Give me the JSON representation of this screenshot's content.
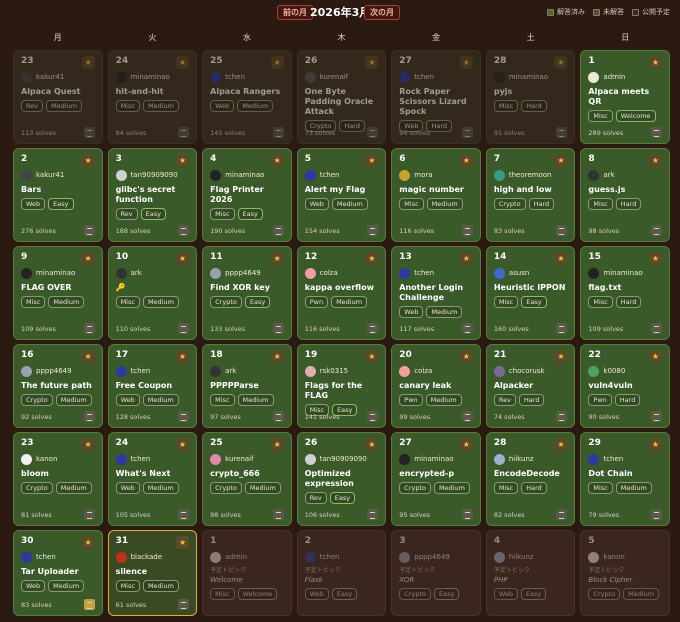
{
  "header": {
    "prev_label": "前の月",
    "title": "2026年3月",
    "next_label": "次の月"
  },
  "legend": [
    {
      "label": "解答済み",
      "color": "#4a6a2a"
    },
    {
      "label": "未解答",
      "color": "#5a4a3a"
    },
    {
      "label": "公開予定",
      "color": "#3a2a22"
    }
  ],
  "weekdays": [
    "月",
    "火",
    "水",
    "木",
    "金",
    "土",
    "日"
  ],
  "days": [
    {
      "day": "23",
      "state": "past",
      "author": "kakur41",
      "avatar_color": "#444444",
      "title": "Alpaca Quest",
      "tags": [
        "Rev",
        "Medium"
      ],
      "solves": "113 solves"
    },
    {
      "day": "24",
      "state": "past",
      "author": "minaminao",
      "avatar_color": "#222222",
      "title": "hit-and-hit",
      "tags": [
        "Misc",
        "Medium"
      ],
      "solves": "84 solves"
    },
    {
      "day": "25",
      "state": "past",
      "author": "tchen",
      "avatar_color": "#2a3aa0",
      "title": "Alpaca Rangers",
      "tags": [
        "Web",
        "Medium"
      ],
      "solves": "145 solves"
    },
    {
      "day": "26",
      "state": "past",
      "author": "kurenaif",
      "avatar_color": "#555555",
      "title": "One Byte Padding Oracle Attack",
      "tags": [
        "Crypto",
        "Hard"
      ],
      "solves": "73 solves"
    },
    {
      "day": "27",
      "state": "past",
      "author": "tchen",
      "avatar_color": "#2a3aa0",
      "title": "Rock Paper Scissors Lizard Spock",
      "tags": [
        "Web",
        "Hard"
      ],
      "solves": "94 solves"
    },
    {
      "day": "28",
      "state": "past",
      "author": "minaminao",
      "avatar_color": "#222222",
      "title": "pyjs",
      "tags": [
        "Misc",
        "Hard"
      ],
      "solves": "91 solves"
    },
    {
      "day": "1",
      "state": "solved",
      "author": "admin",
      "avatar_color": "#f0e8d8",
      "title": "Alpaca meets QR",
      "tags": [
        "Misc",
        "Welcome"
      ],
      "solves": "289 solves"
    },
    {
      "day": "2",
      "state": "solved",
      "author": "kakur41",
      "avatar_color": "#444444",
      "title": "Bars",
      "tags": [
        "Web",
        "Easy"
      ],
      "solves": "276 solves"
    },
    {
      "day": "3",
      "state": "solved",
      "author": "tan90909090",
      "avatar_color": "#d0d0d0",
      "title": "glibc's secret function",
      "tags": [
        "Rev",
        "Easy"
      ],
      "solves": "188 solves"
    },
    {
      "day": "4",
      "state": "solved",
      "author": "minaminao",
      "avatar_color": "#222222",
      "title": "Flag Printer 2026",
      "tags": [
        "Misc",
        "Easy"
      ],
      "solves": "190 solves"
    },
    {
      "day": "5",
      "state": "solved",
      "author": "tchen",
      "avatar_color": "#2a3aa0",
      "title": "Alert my Flag",
      "tags": [
        "Web",
        "Medium"
      ],
      "solves": "154 solves"
    },
    {
      "day": "6",
      "state": "solved",
      "author": "mora",
      "avatar_color": "#c8a030",
      "title": "magic number",
      "tags": [
        "Misc",
        "Medium"
      ],
      "solves": "116 solves"
    },
    {
      "day": "7",
      "state": "solved",
      "author": "theoremoon",
      "avatar_color": "#3a9a8a",
      "title": "high and low",
      "tags": [
        "Crypto",
        "Hard"
      ],
      "solves": "83 solves"
    },
    {
      "day": "8",
      "state": "solved",
      "author": "ark",
      "avatar_color": "#333333",
      "title": "guess.js",
      "tags": [
        "Misc",
        "Hard"
      ],
      "solves": "98 solves"
    },
    {
      "day": "9",
      "state": "solved",
      "author": "minaminao",
      "avatar_color": "#222222",
      "title": "FLAG OVER",
      "tags": [
        "Misc",
        "Medium"
      ],
      "solves": "109 solves"
    },
    {
      "day": "10",
      "state": "solved",
      "author": "ark",
      "avatar_color": "#333333",
      "title": "🔑",
      "tags": [
        "Misc",
        "Medium"
      ],
      "solves": "110 solves"
    },
    {
      "day": "11",
      "state": "solved",
      "author": "pppp4649",
      "avatar_color": "#9aa0b0",
      "title": "Find XOR key",
      "tags": [
        "Crypto",
        "Easy"
      ],
      "solves": "133 solves"
    },
    {
      "day": "12",
      "state": "solved",
      "author": "colza",
      "avatar_color": "#f0a0a0",
      "title": "kappa overflow",
      "tags": [
        "Pwn",
        "Medium"
      ],
      "solves": "116 solves"
    },
    {
      "day": "13",
      "state": "solved",
      "author": "tchen",
      "avatar_color": "#2a3aa0",
      "title": "Another Login Challenge",
      "tags": [
        "Web",
        "Medium"
      ],
      "solves": "117 solves"
    },
    {
      "day": "14",
      "state": "solved",
      "author": "asusn",
      "avatar_color": "#3a6ad0",
      "title": "Heuristic IPPON",
      "tags": [
        "Misc",
        "Easy"
      ],
      "solves": "160 solves"
    },
    {
      "day": "15",
      "state": "solved",
      "author": "minaminao",
      "avatar_color": "#222222",
      "title": "flag.txt",
      "tags": [
        "Misc",
        "Hard"
      ],
      "solves": "109 solves"
    },
    {
      "day": "16",
      "state": "solved",
      "author": "pppp4649",
      "avatar_color": "#9aa0b0",
      "title": "The future path",
      "tags": [
        "Crypto",
        "Medium"
      ],
      "solves": "92 solves"
    },
    {
      "day": "17",
      "state": "solved",
      "author": "tchen",
      "avatar_color": "#2a3aa0",
      "title": "Free Coupon",
      "tags": [
        "Web",
        "Medium"
      ],
      "solves": "128 solves"
    },
    {
      "day": "18",
      "state": "solved",
      "author": "ark",
      "avatar_color": "#333333",
      "title": "PPPPParse",
      "tags": [
        "Misc",
        "Medium"
      ],
      "solves": "97 solves"
    },
    {
      "day": "19",
      "state": "solved",
      "author": "rsk0315",
      "avatar_color": "#e0b0b0",
      "title": "Flags for the FLAG",
      "tags": [
        "Misc",
        "Easy"
      ],
      "solves": "141 solves"
    },
    {
      "day": "20",
      "state": "solved",
      "author": "colza",
      "avatar_color": "#f0a0a0",
      "title": "canary leak",
      "tags": [
        "Pwn",
        "Medium"
      ],
      "solves": "99 solves"
    },
    {
      "day": "21",
      "state": "solved",
      "author": "chocorusk",
      "avatar_color": "#7a6a9a",
      "title": "Alpacker",
      "tags": [
        "Rev",
        "Hard"
      ],
      "solves": "74 solves"
    },
    {
      "day": "22",
      "state": "solved",
      "author": "k0080",
      "avatar_color": "#50a060",
      "title": "vuln4vuln",
      "tags": [
        "Pwn",
        "Hard"
      ],
      "solves": "90 solves"
    },
    {
      "day": "23",
      "state": "solved",
      "author": "kanon",
      "avatar_color": "#f0f0f0",
      "title": "bloom",
      "tags": [
        "Crypto",
        "Medium"
      ],
      "solves": "81 solves"
    },
    {
      "day": "24",
      "state": "solved",
      "author": "tchen",
      "avatar_color": "#2a3aa0",
      "title": "What's Next",
      "tags": [
        "Web",
        "Medium"
      ],
      "solves": "105 solves"
    },
    {
      "day": "25",
      "state": "solved",
      "author": "kurenaif",
      "avatar_color": "#e08aa8",
      "title": "crypto_666",
      "tags": [
        "Crypto",
        "Medium"
      ],
      "solves": "98 solves"
    },
    {
      "day": "26",
      "state": "solved",
      "author": "tan90909090",
      "avatar_color": "#d0d0d0",
      "title": "Optimized expression",
      "tags": [
        "Rev",
        "Easy"
      ],
      "solves": "106 solves"
    },
    {
      "day": "27",
      "state": "solved",
      "author": "minaminao",
      "avatar_color": "#222222",
      "title": "encrypted-p",
      "tags": [
        "Crypto",
        "Medium"
      ],
      "solves": "95 solves"
    },
    {
      "day": "28",
      "state": "solved",
      "author": "hiikunz",
      "avatar_color": "#a0b0d0",
      "title": "EncodeDecode",
      "tags": [
        "Misc",
        "Hard"
      ],
      "solves": "82 solves"
    },
    {
      "day": "29",
      "state": "solved",
      "author": "tchen",
      "avatar_color": "#2a3aa0",
      "title": "Dot Chain",
      "tags": [
        "Misc",
        "Medium"
      ],
      "solves": "79 solves"
    },
    {
      "day": "30",
      "state": "solved",
      "author": "tchen",
      "avatar_color": "#2a3aa0",
      "title": "Tar Uploader",
      "tags": [
        "Web",
        "Medium"
      ],
      "solves": "83 solves",
      "highlight_doc": true
    },
    {
      "day": "31",
      "state": "today",
      "author": "blackade",
      "avatar_color": "#c03020",
      "title": "silence",
      "tags": [
        "Misc",
        "Medium"
      ],
      "solves": "61 solves"
    },
    {
      "day": "1",
      "state": "future",
      "author": "admin",
      "avatar_color": "#f0e8d8",
      "upcoming": "予定トピック",
      "title": "Welcome",
      "tags": [
        "Misc",
        "Welcome"
      ]
    },
    {
      "day": "2",
      "state": "future",
      "author": "tchen",
      "avatar_color": "#2a3aa0",
      "upcoming": "予定トピック",
      "title": "Flask",
      "tags": [
        "Web",
        "Easy"
      ]
    },
    {
      "day": "3",
      "state": "future",
      "author": "pppp4649",
      "avatar_color": "#9aa0b0",
      "upcoming": "予定トピック",
      "title": "XOR",
      "tags": [
        "Crypto",
        "Easy"
      ]
    },
    {
      "day": "4",
      "state": "future",
      "author": "hiikunz",
      "avatar_color": "#a0b0d0",
      "upcoming": "予定トピック",
      "title": "PHP",
      "tags": [
        "Web",
        "Easy"
      ]
    },
    {
      "day": "5",
      "state": "future",
      "author": "kanon",
      "avatar_color": "#f0f0f0",
      "upcoming": "予定トピック",
      "title": "Block Cipher",
      "tags": [
        "Crypto",
        "Medium"
      ]
    }
  ]
}
